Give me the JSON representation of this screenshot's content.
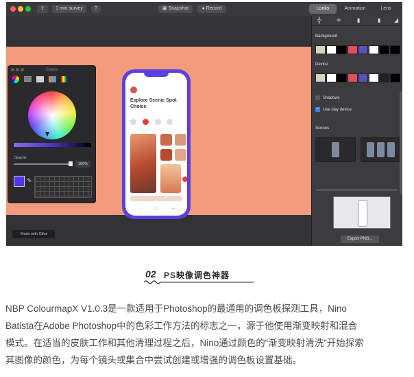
{
  "toolbar": {
    "survey_label": "1 min survey",
    "help_label": "?",
    "snapshot_label": "Snapshot",
    "record_label": "Record",
    "tabs": [
      {
        "label": "Looks",
        "active": true
      },
      {
        "label": "Animation",
        "active": false
      },
      {
        "label": "Lens",
        "active": false
      }
    ]
  },
  "colors_panel": {
    "title": "Colors",
    "opacity_label": "Opacity",
    "opacity_value": "100%",
    "selected_color": "#5535e6"
  },
  "phone": {
    "title": "Explore Scenic Spot Choice"
  },
  "right_panel": {
    "background_label": "Background",
    "device_label": "Device",
    "shadows_label": "Shadows",
    "clay_label": "Use clay device",
    "scenes_label": "Scenes",
    "export_label": "Export PNG...",
    "background_swatches": [
      "#d8d2c0",
      "#ffffff",
      "#000000",
      "#e24f5a",
      "#5a4fb8",
      "#ffffff",
      "#000000",
      "#000000"
    ],
    "device_swatches": [
      "#d8d2c0",
      "#ffffff",
      "#000000",
      "#e24f5a",
      "#5a4fb8",
      "#ffffff",
      "#222222",
      "#000000"
    ]
  },
  "badge": {
    "label": "Made with Gifox"
  },
  "article": {
    "heading_number": "02",
    "heading_text": "PS映像调色神器",
    "lines": [
      "NBP ColourmapX V1.0.3是一款适用于Photoshop的最通用的调色板探测工具，Nino",
      "Batista在Adobe Photoshop中的色彩工作方法的标志之一，源于他使用渐变映射和混合",
      "模式。在适当的皮肤工作和其他清理过程之后，Nino通过颜色的“渐变映射清洗”开始探索",
      "其图像的颜色，为每个镜头或集合中尝试创建或增强的调色板设置基础。"
    ]
  }
}
